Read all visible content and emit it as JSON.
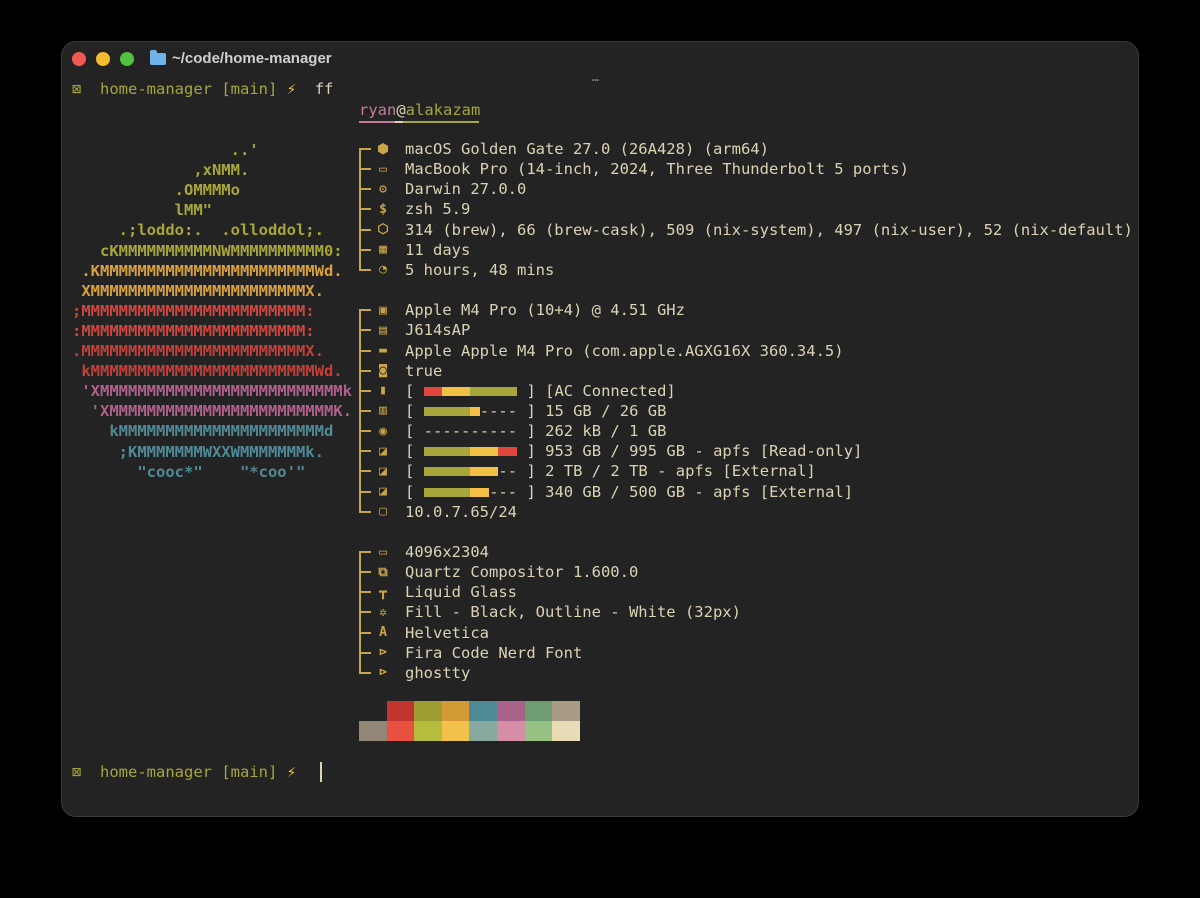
{
  "window": {
    "title": "~/code/home-manager",
    "dots": "…"
  },
  "prompt": {
    "dir": "home-manager",
    "branch": "[main]",
    "bolt": "⚡",
    "cmd": "ff"
  },
  "user": "ryan",
  "at": "@",
  "host": "alakazam",
  "art": [
    {
      "text": "                 ..'",
      "color": "#a6a63a"
    },
    {
      "text": "             ,xNMM.",
      "color": "#a6a63a"
    },
    {
      "text": "           .OMMMMo",
      "color": "#a6a63a"
    },
    {
      "text": "           lMM\"",
      "color": "#a6a63a"
    },
    {
      "text": "     .;loddo:.  .olloddol;.",
      "color": "#a6a63a"
    },
    {
      "text": "   cKMMMMMMMMMMNWMMMMMMMMMM0:",
      "color": "#a6a63a"
    },
    {
      "text": " .KMMMMMMMMMMMMMMMMMMMMMMMWd.",
      "color": "#d9a03e"
    },
    {
      "text": " XMMMMMMMMMMMMMMMMMMMMMMMX.",
      "color": "#d9a03e"
    },
    {
      "text": ";MMMMMMMMMMMMMMMMMMMMMMMM:",
      "color": "#d0453d"
    },
    {
      "text": ":MMMMMMMMMMMMMMMMMMMMMMMM:",
      "color": "#d0453d"
    },
    {
      "text": ".MMMMMMMMMMMMMMMMMMMMMMMMX.",
      "color": "#c2403a"
    },
    {
      "text": " kMMMMMMMMMMMMMMMMMMMMMMMMWd.",
      "color": "#c2403a"
    },
    {
      "text": " 'XMMMMMMMMMMMMMMMMMMMMMMMMMMk",
      "color": "#b0608a"
    },
    {
      "text": "  'XMMMMMMMMMMMMMMMMMMMMMMMMK.",
      "color": "#b0608a"
    },
    {
      "text": "    kMMMMMMMMMMMMMMMMMMMMMMd",
      "color": "#4f8a96"
    },
    {
      "text": "     ;KMMMMMMMWXXWMMMMMMMk.",
      "color": "#4f8a96"
    },
    {
      "text": "       \"cooc*\"    \"*coo'\"",
      "color": "#4f8a96"
    }
  ],
  "groups": [
    {
      "rows": [
        {
          "icon": "apple-icon",
          "glyph": "⬢",
          "text": "macOS Golden Gate 27.0 (26A428) (arm64)"
        },
        {
          "icon": "laptop-icon",
          "glyph": "▭",
          "text": "MacBook Pro (14-inch, 2024, Three Thunderbolt 5 ports)"
        },
        {
          "icon": "kernel-icon",
          "glyph": "⚙",
          "text": "Darwin 27.0.0"
        },
        {
          "icon": "shell-icon",
          "glyph": "$",
          "text": "zsh 5.9"
        },
        {
          "icon": "package-icon",
          "glyph": "⬡",
          "text": "314 (brew), 66 (brew-cask), 509 (nix-system), 497 (nix-user), 52 (nix-default)"
        },
        {
          "icon": "calendar-icon",
          "glyph": "▦",
          "text": "11 days"
        },
        {
          "icon": "clock-icon",
          "glyph": "◔",
          "text": "5 hours, 48 mins"
        }
      ]
    },
    {
      "rows": [
        {
          "icon": "cpu-icon",
          "glyph": "▣",
          "text": "Apple M4 Pro (10+4) @ 4.51 GHz"
        },
        {
          "icon": "board-icon",
          "glyph": "▤",
          "text": "J614sAP"
        },
        {
          "icon": "gpu-icon",
          "glyph": "▬",
          "text": "Apple Apple M4 Pro (com.apple.AGXG16X 360.34.5)"
        },
        {
          "icon": "speaker-icon",
          "glyph": "◙",
          "text": "true"
        },
        {
          "icon": "battery-icon",
          "glyph": "▮",
          "bar": {
            "fill": 10,
            "colors": [
              "#e0463a",
              "#e0463a",
              "#f2c045",
              "#f2c045",
              "#f2c045",
              "#a6a63a",
              "#a6a63a",
              "#a6a63a",
              "#a6a63a",
              "#a6a63a"
            ]
          },
          "text": "[AC Connected]"
        },
        {
          "icon": "memory-icon",
          "glyph": "▥",
          "bar": {
            "fill": 6,
            "colors": [
              "#a6a63a",
              "#a6a63a",
              "#a6a63a",
              "#a6a63a",
              "#a6a63a",
              "#f2c045"
            ]
          },
          "text": "15 GB / 26 GB"
        },
        {
          "icon": "swap-icon",
          "glyph": "◉",
          "bar": {
            "fill": 0,
            "colors": []
          },
          "text": "262 kB / 1 GB"
        },
        {
          "icon": "disk-icon",
          "glyph": "◪",
          "bar": {
            "fill": 10,
            "colors": [
              "#a6a63a",
              "#a6a63a",
              "#a6a63a",
              "#a6a63a",
              "#a6a63a",
              "#f2c045",
              "#f2c045",
              "#f2c045",
              "#e0463a",
              "#e0463a"
            ]
          },
          "text": "953 GB / 995 GB - apfs [Read-only]"
        },
        {
          "icon": "disk-icon",
          "glyph": "◪",
          "bar": {
            "fill": 8,
            "colors": [
              "#a6a63a",
              "#a6a63a",
              "#a6a63a",
              "#a6a63a",
              "#a6a63a",
              "#f2c045",
              "#f2c045",
              "#f2c045"
            ]
          },
          "text": "2 TB / 2 TB - apfs [External]"
        },
        {
          "icon": "disk-icon",
          "glyph": "◪",
          "bar": {
            "fill": 7,
            "colors": [
              "#a6a63a",
              "#a6a63a",
              "#a6a63a",
              "#a6a63a",
              "#a6a63a",
              "#f2c045",
              "#f2c045"
            ]
          },
          "text": "340 GB / 500 GB - apfs [External]"
        },
        {
          "icon": "ip-icon",
          "glyph": "▢",
          "text": "10.0.7.65/24"
        }
      ]
    },
    {
      "rows": [
        {
          "icon": "display-icon",
          "glyph": "▭",
          "text": "4096x2304"
        },
        {
          "icon": "window-manager-icon",
          "glyph": "⧉",
          "text": "Quartz Compositor 1.600.0"
        },
        {
          "icon": "paint-roller-icon",
          "glyph": "┳",
          "text": "Liquid Glass"
        },
        {
          "icon": "cursor-icon",
          "glyph": "✲",
          "text": "Fill - Black, Outline - White (32px)"
        },
        {
          "icon": "font-icon",
          "glyph": "A",
          "text": "Helvetica"
        },
        {
          "icon": "terminal-font-icon",
          "glyph": "⊳",
          "text": "Fira Code Nerd Font"
        },
        {
          "icon": "terminal-icon",
          "glyph": "⊳",
          "text": "ghostty"
        }
      ]
    }
  ],
  "palette": {
    "top": [
      "#232323",
      "#c2352e",
      "#9d9d33",
      "#d39a35",
      "#4e8a95",
      "#a8628a",
      "#6f9d72",
      "#a89a85"
    ],
    "bottom": [
      "#928676",
      "#e8503f",
      "#b6bc3e",
      "#f2c14a",
      "#88a9a0",
      "#d58ea5",
      "#97c083",
      "#e8dcb6"
    ]
  },
  "bracket_open": "[",
  "bracket_close": "]"
}
